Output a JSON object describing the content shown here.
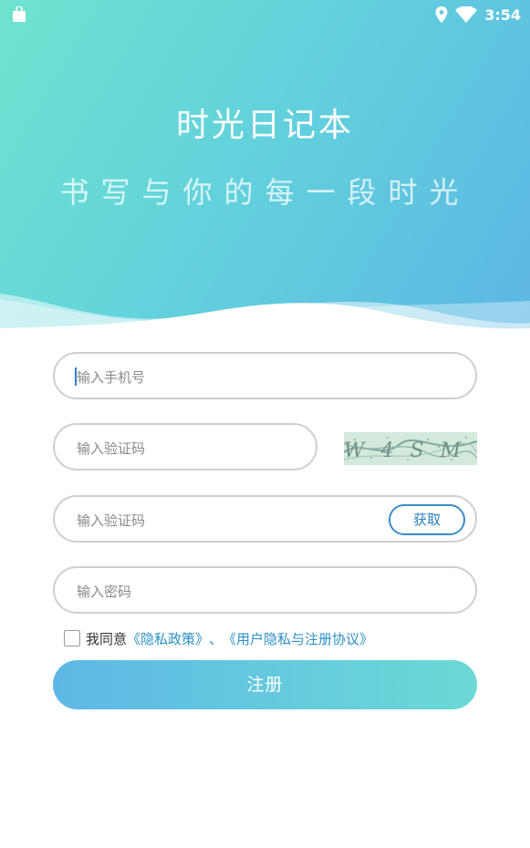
{
  "status_bar": {
    "time": "3:54",
    "icons": [
      "bag-icon",
      "location-icon",
      "wifi-icon"
    ]
  },
  "header": {
    "title": "时光日记本",
    "subtitle": "书写与你的每一段时光"
  },
  "form": {
    "phone": {
      "placeholder": "输入手机号",
      "value": ""
    },
    "captcha": {
      "placeholder": "输入验证码",
      "value": "",
      "image_text": "W4SM"
    },
    "sms_code": {
      "placeholder": "输入验证码",
      "value": "",
      "get_button": "获取"
    },
    "password": {
      "placeholder": "输入密码",
      "value": ""
    }
  },
  "agreement": {
    "prefix": "我同意",
    "privacy_link": "《隐私政策》",
    "separator": "、",
    "terms_link": "《用户隐私与注册协议》",
    "checked": false
  },
  "submit_label": "注册",
  "colors": {
    "gradient_start": "#6fe3cf",
    "gradient_end": "#5db6e4",
    "link": "#2a8fc6",
    "button_start": "#5eb8e6",
    "button_end": "#6cd9d6"
  }
}
